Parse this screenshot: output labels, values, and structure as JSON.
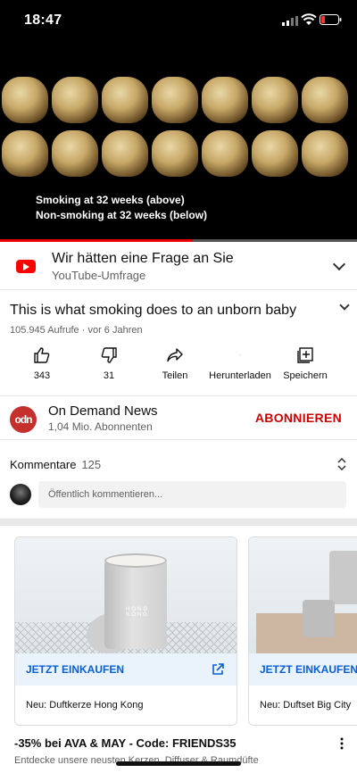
{
  "status_bar": {
    "time": "18:47"
  },
  "video": {
    "caption_line1": "Smoking at 32 weeks (above)",
    "caption_line2": "Non-smoking at 32 weeks (below)",
    "progress": 0.54
  },
  "survey": {
    "title": "Wir hätten eine Frage an Sie",
    "subtitle": "YouTube-Umfrage"
  },
  "video_info": {
    "title": "This is what smoking does to an unborn baby",
    "meta": "105.945 Aufrufe · vor 6 Jahren"
  },
  "actions": {
    "likes": "343",
    "dislikes": "31",
    "share": "Teilen",
    "download": "Herunterladen",
    "save": "Speichern"
  },
  "channel": {
    "avatar_text": "odn",
    "name": "On Demand News",
    "subscribers": "1,04 Mio. Abonnenten",
    "subscribe": "ABONNIEREN"
  },
  "comments": {
    "label": "Kommentare",
    "count": "125",
    "placeholder": "Öffentlich kommentieren..."
  },
  "ad": {
    "cards": [
      {
        "cta": "JETZT EINKAUFEN",
        "description": "Neu: Duftkerze Hong Kong",
        "product_label": "HONG KONG"
      },
      {
        "cta": "JETZT EINKAUFEN",
        "description": "Neu: Duftset Big City"
      }
    ],
    "title": "-35% bei AVA & MAY - Code: FRIENDS35",
    "subtitle": "Entdecke unsere neusten Kerzen, Diffuser & Raumdüfte"
  },
  "colors": {
    "accent_red": "#cc0000",
    "link_blue": "#065fd4"
  }
}
